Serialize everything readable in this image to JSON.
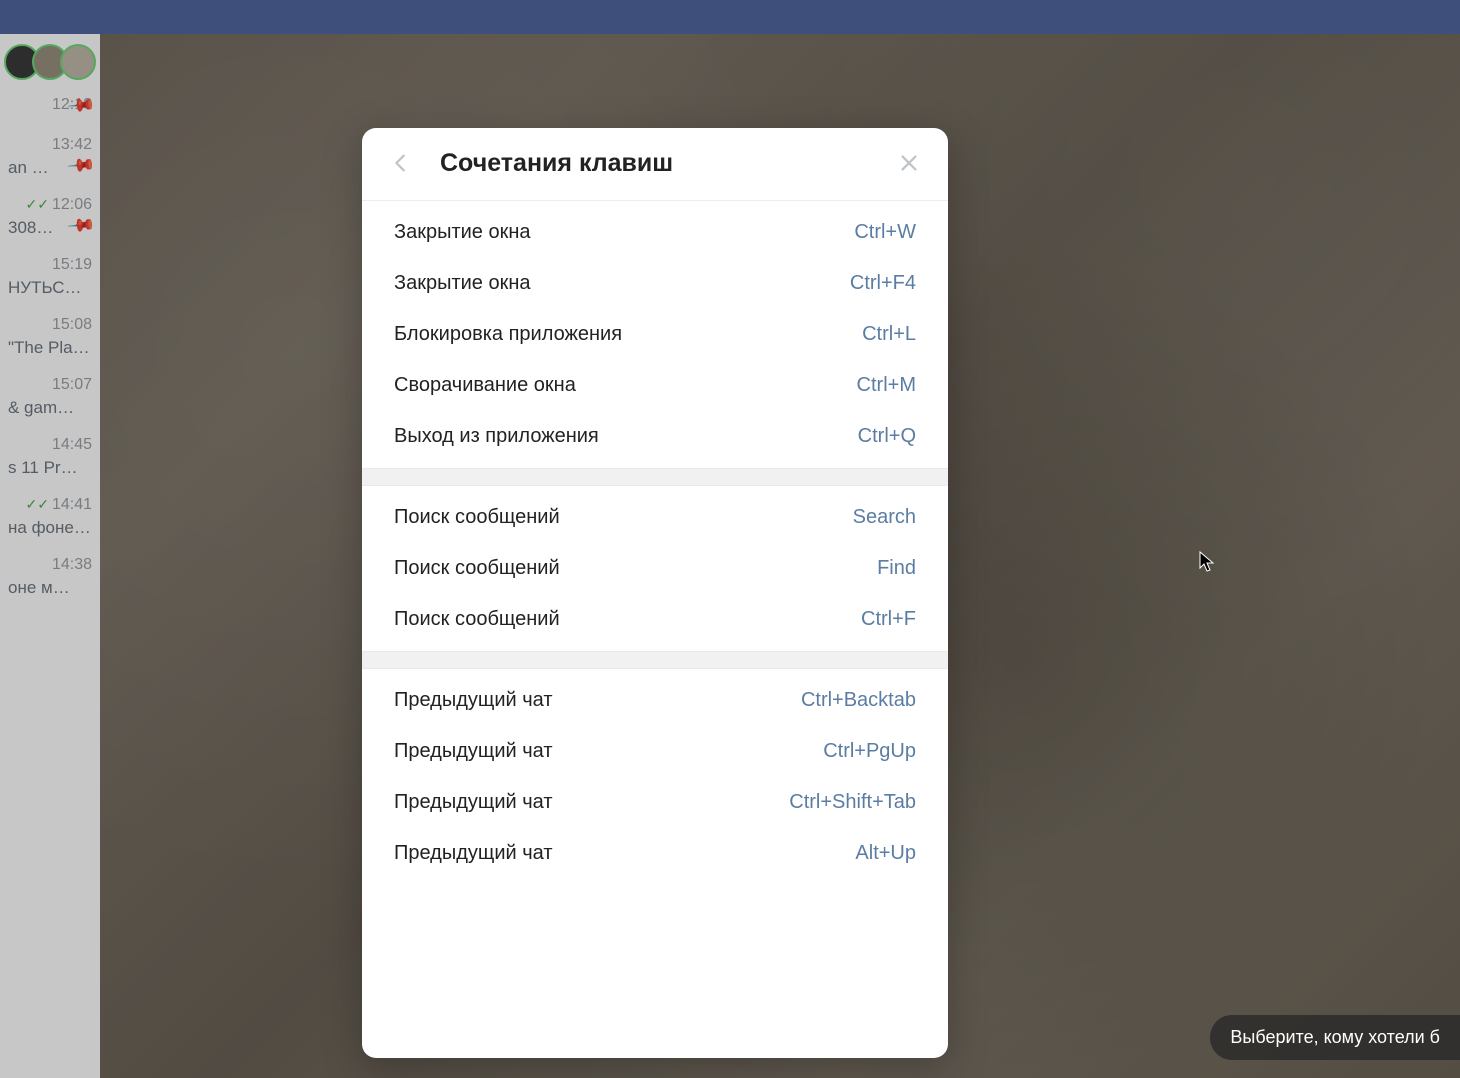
{
  "dialog": {
    "title": "Сочетания клавиш",
    "sections": [
      [
        {
          "label": "Закрытие окна",
          "key": "Ctrl+W"
        },
        {
          "label": "Закрытие окна",
          "key": "Ctrl+F4"
        },
        {
          "label": "Блокировка приложения",
          "key": "Ctrl+L"
        },
        {
          "label": "Сворачивание окна",
          "key": "Ctrl+M"
        },
        {
          "label": "Выход из приложения",
          "key": "Ctrl+Q"
        }
      ],
      [
        {
          "label": "Поиск сообщений",
          "key": "Search"
        },
        {
          "label": "Поиск сообщений",
          "key": "Find"
        },
        {
          "label": "Поиск сообщений",
          "key": "Ctrl+F"
        }
      ],
      [
        {
          "label": "Предыдущий чат",
          "key": "Ctrl+Backtab"
        },
        {
          "label": "Предыдущий чат",
          "key": "Ctrl+PgUp"
        },
        {
          "label": "Предыдущий чат",
          "key": "Ctrl+Shift+Tab"
        },
        {
          "label": "Предыдущий чат",
          "key": "Alt+Up"
        }
      ]
    ]
  },
  "sidebar": {
    "items": [
      {
        "time": "12:18",
        "check": false,
        "preview": "",
        "pinned": true
      },
      {
        "time": "13:42",
        "check": false,
        "preview": "an …",
        "pinned": true
      },
      {
        "time": "12:06",
        "check": true,
        "preview": "308…",
        "pinned": true
      },
      {
        "time": "15:19",
        "check": false,
        "preview": "НУТЬСЯ…",
        "pinned": false
      },
      {
        "time": "15:08",
        "check": false,
        "preview": "\"The Pla…",
        "pinned": false
      },
      {
        "time": "15:07",
        "check": false,
        "preview": "& gam…",
        "pinned": false
      },
      {
        "time": "14:45",
        "check": false,
        "preview": "s 11 Pr…",
        "pinned": false
      },
      {
        "time": "14:41",
        "check": true,
        "preview": "на фоне…",
        "pinned": false
      },
      {
        "time": "14:38",
        "check": false,
        "preview": "оне м…",
        "pinned": false
      }
    ]
  },
  "tooltip": "Выберите, кому хотели б"
}
